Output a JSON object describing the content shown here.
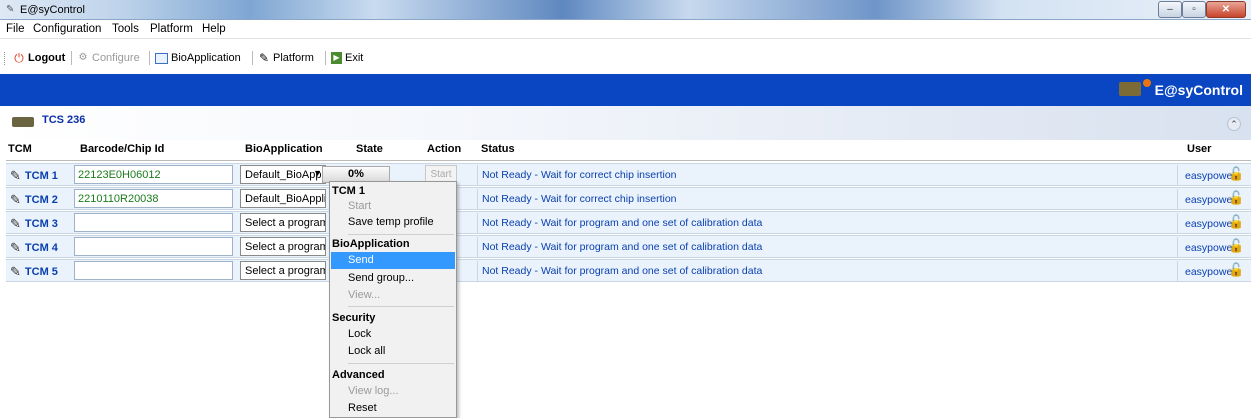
{
  "window": {
    "title": "E@syControl"
  },
  "menu": [
    "File",
    "Configuration",
    "Tools",
    "Platform",
    "Help"
  ],
  "toolbar": {
    "logout": "Logout",
    "configure": "Configure",
    "bioapplication": "BioApplication",
    "platform": "Platform",
    "exit": "Exit"
  },
  "banner": {
    "brand": "E@syControl"
  },
  "section": {
    "label": "TCS 236"
  },
  "table": {
    "headers": [
      "TCM",
      "Barcode/Chip Id",
      "BioApplication",
      "State",
      "Action",
      "Status",
      "User"
    ],
    "rows": [
      {
        "tcm": "TCM 1",
        "barcode": "22123E0H06012",
        "bioapp": "Default_BioApplica",
        "state": "0%",
        "action": "Start",
        "status": "Not Ready - Wait for correct chip insertion",
        "user": "easypower"
      },
      {
        "tcm": "TCM 2",
        "barcode": "2210110R20038",
        "bioapp": "Default_BioApplica",
        "state": "",
        "action": "",
        "status": "Not Ready - Wait for correct chip insertion",
        "user": "easypower"
      },
      {
        "tcm": "TCM 3",
        "barcode": "",
        "bioapp": "Select a program",
        "state": "",
        "action": "",
        "status": "Not Ready - Wait for program and one set of calibration data",
        "user": "easypower"
      },
      {
        "tcm": "TCM 4",
        "barcode": "",
        "bioapp": "Select a program",
        "state": "",
        "action": "",
        "status": "Not Ready - Wait for program and one set of calibration data",
        "user": "easypower"
      },
      {
        "tcm": "TCM 5",
        "barcode": "",
        "bioapp": "Select a program",
        "state": "",
        "action": "",
        "status": "Not Ready - Wait for program and one set of calibration data",
        "user": "easypower"
      }
    ]
  },
  "context_menu": {
    "tcm_header": "TCM 1",
    "start": "Start",
    "save_temp_profile": "Save temp profile",
    "bio_header": "BioApplication",
    "send": "Send",
    "send_group": "Send group...",
    "view": "View...",
    "security_header": "Security",
    "lock": "Lock",
    "lock_all": "Lock all",
    "advanced_header": "Advanced",
    "view_log": "View log...",
    "reset": "Reset"
  },
  "colors": {
    "banner": "#0a46c2",
    "link_blue": "#0a3fb0",
    "row_bg": "#eaf3fb",
    "menu_highlight": "#3399ff",
    "barcode_green": "#1b7a1b"
  }
}
